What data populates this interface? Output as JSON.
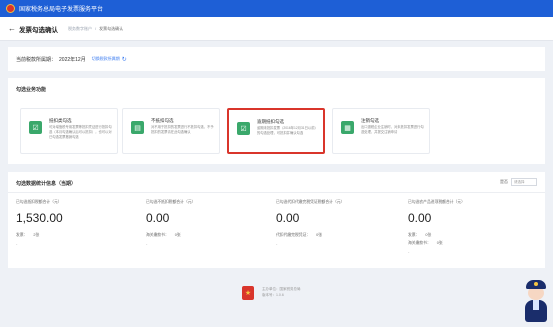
{
  "topbar": {
    "title": "国家税务总局电子发票服务平台"
  },
  "nav": {
    "back_icon": "arrow-left-icon",
    "title": "发票勾选确认",
    "breadcrumbs": [
      "税务数字账户",
      "发票勾选确认"
    ]
  },
  "period": {
    "label": "当前税款所属期：",
    "value": "2022年12月",
    "link": "切换税款所属期",
    "refresh_icon": "refresh-icon"
  },
  "ops": {
    "title": "勾选业务功能",
    "cards": [
      {
        "title": "抵扣类勾选",
        "desc": "可对增值税专用发票等抵扣凭证进行抵扣勾选（本月勾选确认后可以抵扣），也可以对已勾选发票撤销勾选",
        "icon": "checklist-icon"
      },
      {
        "title": "不抵扣勾选",
        "desc": "对不用于抵扣的发票进行不抵扣勾选，不予抵扣的发票请在此勾选确认",
        "icon": "form-icon"
      },
      {
        "title": "逾期抵扣勾选",
        "desc": "逾期未抵扣发票（2016年12月31日以前）的勾选处理，可抵扣并确认勾选",
        "icon": "checklist-icon"
      },
      {
        "title": "注销勾选",
        "desc": "出口退税企业注销时，对未抵扣发票进行勾选处理，并提交注销申请",
        "icon": "document-icon"
      }
    ]
  },
  "stats": {
    "title": "勾选数据统计信息（当期）",
    "filter_label": "是否",
    "filter_value": "请选择",
    "items": [
      {
        "label": "已勾选抵扣税额合计（元）",
        "value": "1,530.00",
        "row_label": "发票：",
        "row_value": "2张",
        "dash": "-"
      },
      {
        "label": "已勾选不抵扣税额合计（元）",
        "value": "0.00",
        "row_label": "海关缴款书：",
        "row_value": "0张",
        "dash": "-"
      },
      {
        "label": "已勾选代扣代缴完税凭证税额合计（元）",
        "value": "0.00",
        "row_label": "代扣代缴完税凭证：",
        "row_value": "0张",
        "dash": "-"
      },
      {
        "label": "已勾选农产品进项税额合计（元）",
        "value": "0.00",
        "row_label": "发票：",
        "row_value": "0张",
        "row2_label": "海关缴款书：",
        "row2_value": "0张",
        "dash": "-"
      }
    ]
  },
  "footer": {
    "line1": "主办单位：国家税务总局",
    "line2": "版本号：1.0.6"
  }
}
